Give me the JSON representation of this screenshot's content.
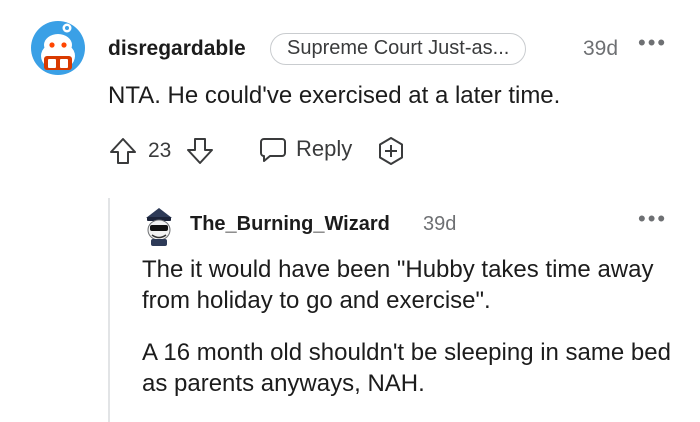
{
  "comment": {
    "username": "disregardable",
    "flair": "Supreme Court Just-as...",
    "time": "39d",
    "more": "•••",
    "body": "NTA. He could've exercised at a later time.",
    "score": "23",
    "reply_label": "Reply"
  },
  "reply": {
    "username": "The_Burning_Wizard",
    "time": "39d",
    "more": "•••",
    "paragraphs": [
      "The it would have been \"Hubby takes time away from holiday to go and exercise\".",
      "A 16 month old shouldn't be sleeping in same bed as parents anyways, NAH."
    ]
  },
  "icons": {
    "upvote": "arrow-up-icon",
    "downvote": "arrow-down-icon",
    "reply": "speech-bubble-icon",
    "award": "award-plus-icon",
    "more": "more-dots-icon"
  },
  "colors": {
    "avatar1_bg": "#3aa0e6",
    "text_primary": "#1c1c1c",
    "text_secondary": "#6e7073",
    "thread_line": "#e2e4e6"
  }
}
